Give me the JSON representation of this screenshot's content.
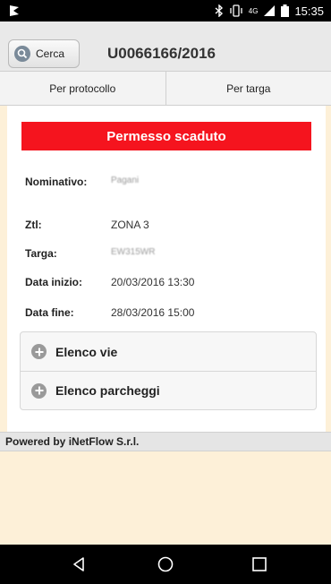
{
  "status_bar": {
    "time": "15:35",
    "network_label": "4G",
    "icons": [
      "app-notification-icon",
      "bluetooth-icon",
      "vibrate-icon",
      "signal-icon",
      "battery-icon"
    ]
  },
  "header": {
    "search_label": "Cerca",
    "title": "U0066166/2016"
  },
  "tabs": [
    {
      "label": "Per protocollo"
    },
    {
      "label": "Per targa"
    }
  ],
  "alert": {
    "text": "Permesso scaduto",
    "color": "#f5141e"
  },
  "details": {
    "nominativo": {
      "label": "Nominativo:",
      "value": "Pagani"
    },
    "ztl": {
      "label": "Ztl:",
      "value": "ZONA 3"
    },
    "targa": {
      "label": "Targa:",
      "value": "EW315WR"
    },
    "data_inizio": {
      "label": "Data inizio:",
      "value": "20/03/2016 13:30"
    },
    "data_fine": {
      "label": "Data fine:",
      "value": "28/03/2016 15:00"
    }
  },
  "collapsibles": [
    {
      "label": "Elenco vie"
    },
    {
      "label": "Elenco parcheggi"
    }
  ],
  "footer": {
    "text": "Powered by iNetFlow S.r.l."
  },
  "nav": [
    "back-icon",
    "home-icon",
    "recents-icon"
  ]
}
